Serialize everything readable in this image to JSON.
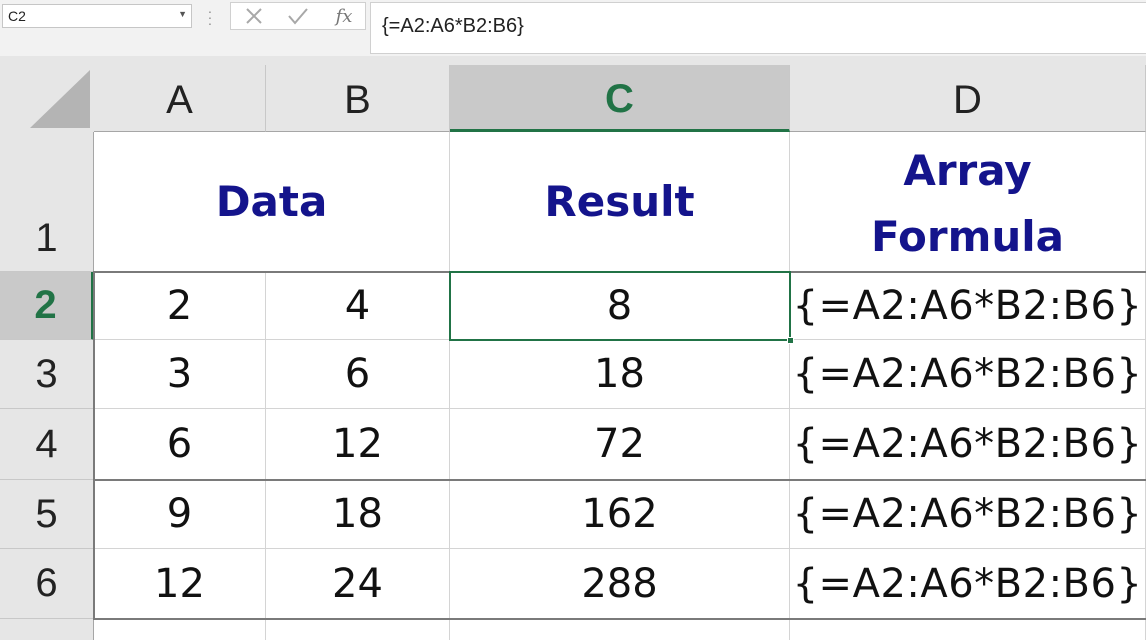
{
  "formula_bar": {
    "name_box": "C2",
    "fx_label": "fx",
    "formula": "{=A2:A6*B2:B6}"
  },
  "columns": [
    "A",
    "B",
    "C",
    "D"
  ],
  "rows": [
    "1",
    "2",
    "3",
    "4",
    "5",
    "6"
  ],
  "active_cell": "C2",
  "header_row": {
    "data": "Data",
    "result": "Result",
    "formula_line1": "Array",
    "formula_line2": "Formula"
  },
  "data_rows": [
    {
      "a": "2",
      "b": "4",
      "c": "8",
      "d": "{=A2:A6*B2:B6}"
    },
    {
      "a": "3",
      "b": "6",
      "c": "18",
      "d": "{=A2:A6*B2:B6}"
    },
    {
      "a": "6",
      "b": "12",
      "c": "72",
      "d": "{=A2:A6*B2:B6}"
    },
    {
      "a": "9",
      "b": "18",
      "c": "162",
      "d": "{=A2:A6*B2:B6}"
    },
    {
      "a": "12",
      "b": "24",
      "c": "288",
      "d": "{=A2:A6*B2:B6}"
    }
  ],
  "colors": {
    "accent": "#217346",
    "header_text": "#14148c"
  }
}
